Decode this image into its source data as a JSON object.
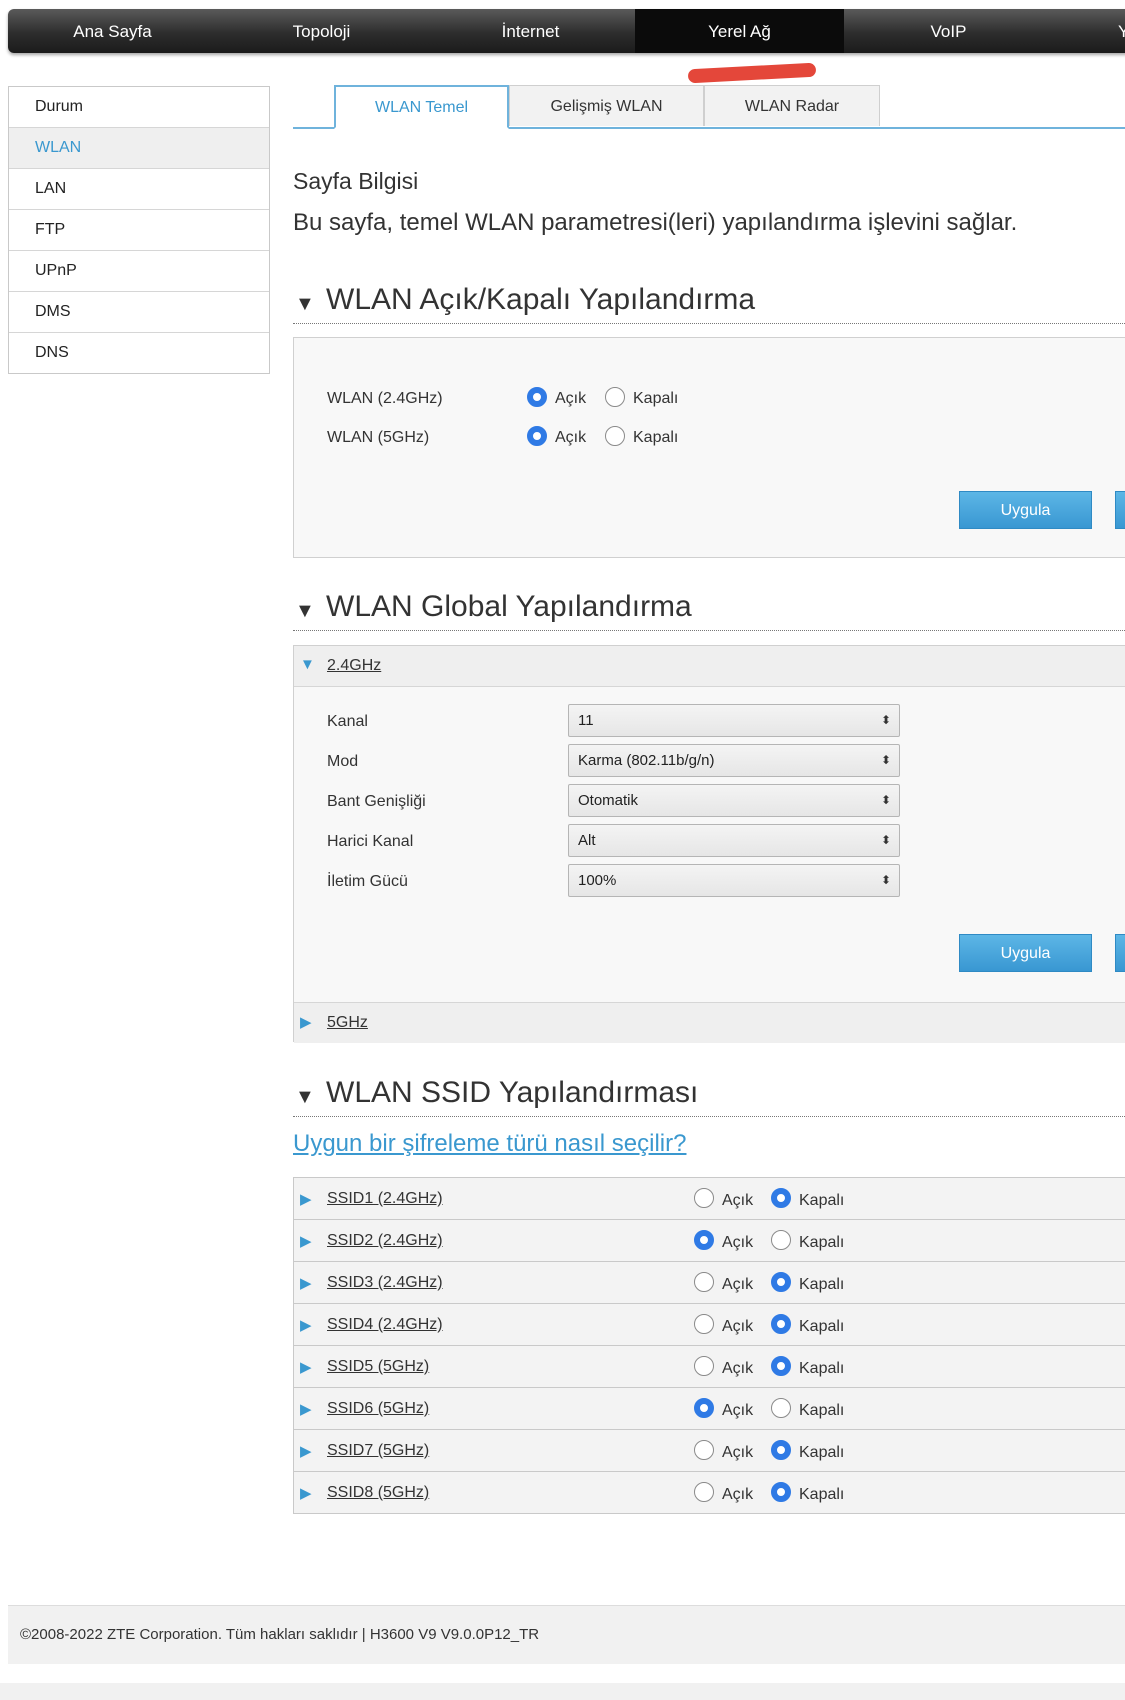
{
  "topnav": {
    "items": [
      "Ana Sayfa",
      "Topoloji",
      "İnternet",
      "Yerel Ağ",
      "VoIP",
      "Yö"
    ],
    "active": "Yerel Ağ"
  },
  "sidebar": {
    "items": [
      "Durum",
      "WLAN",
      "LAN",
      "FTP",
      "UPnP",
      "DMS",
      "DNS"
    ],
    "active": "WLAN"
  },
  "tabs": {
    "items": [
      "WLAN Temel",
      "Gelişmiş WLAN",
      "WLAN Radar"
    ],
    "active": "WLAN Temel"
  },
  "page_info": {
    "title": "Sayfa Bilgisi",
    "description": "Bu sayfa, temel WLAN parametresi(leri) yapılandırma işlevini sağlar."
  },
  "onoff_section": {
    "title": "WLAN Açık/Kapalı Yapılandırma",
    "rows": [
      {
        "label": "WLAN (2.4GHz)",
        "on_label": "Açık",
        "off_label": "Kapalı",
        "selected": "on"
      },
      {
        "label": "WLAN (5GHz)",
        "on_label": "Açık",
        "off_label": "Kapalı",
        "selected": "on"
      }
    ],
    "apply_label": "Uygula"
  },
  "global_section": {
    "title": "WLAN Global Yapılandırma",
    "band_24": "2.4GHz",
    "band_5": "5GHz",
    "fields": [
      {
        "label": "Kanal",
        "value": "11"
      },
      {
        "label": "Mod",
        "value": "Karma (802.11b/g/n)"
      },
      {
        "label": "Bant Genişliği",
        "value": "Otomatik"
      },
      {
        "label": "Harici Kanal",
        "value": "Alt"
      },
      {
        "label": "İletim Gücü",
        "value": "100%"
      }
    ],
    "apply_label": "Uygula"
  },
  "ssid_section": {
    "title": "WLAN SSID Yapılandırması",
    "help_link": "Uygun bir şifreleme türü nasıl seçilir?",
    "on_label": "Açık",
    "off_label": "Kapalı",
    "rows": [
      {
        "name": "SSID1 (2.4GHz)",
        "selected": "off"
      },
      {
        "name": "SSID2 (2.4GHz)",
        "selected": "on"
      },
      {
        "name": "SSID3 (2.4GHz)",
        "selected": "off"
      },
      {
        "name": "SSID4 (2.4GHz)",
        "selected": "off"
      },
      {
        "name": "SSID5 (5GHz)",
        "selected": "off"
      },
      {
        "name": "SSID6 (5GHz)",
        "selected": "on"
      },
      {
        "name": "SSID7 (5GHz)",
        "selected": "off"
      },
      {
        "name": "SSID8 (5GHz)",
        "selected": "off"
      }
    ]
  },
  "footer": {
    "text": "©2008-2022 ZTE Corporation. Tüm hakları saklıdır  |   H3600 V9 V9.0.0P12_TR"
  },
  "colors": {
    "accent": "#3a98cf",
    "radio": "#2f7ae5",
    "annotation": "#e4473a",
    "nav_dark": "#1b1b1b"
  }
}
